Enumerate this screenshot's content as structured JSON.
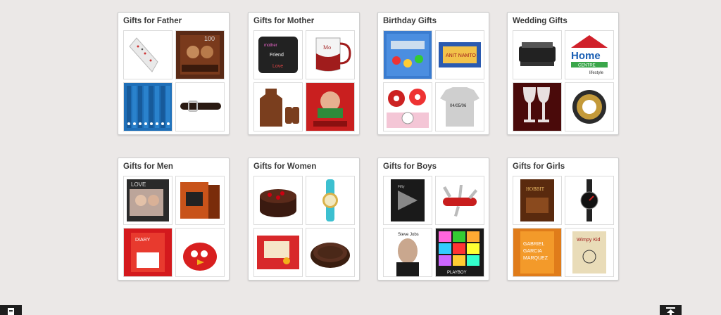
{
  "categories": [
    {
      "title": "Gifts for Father",
      "items": [
        "tie",
        "dvd",
        "books",
        "belt"
      ]
    },
    {
      "title": "Gifts for Mother",
      "items": [
        "cushion",
        "mug",
        "apron",
        "cookbook"
      ]
    },
    {
      "title": "Birthday Gifts",
      "items": [
        "toy-kit",
        "name-banner",
        "cupcakes",
        "tshirt"
      ],
      "image_text": {
        "name-banner": "ANIT NAMTO",
        "tshirt": "04/05/06"
      }
    },
    {
      "title": "Wedding Gifts",
      "items": [
        "grill",
        "home-centre-logo",
        "wine-glasses",
        "wreath"
      ],
      "image_text": {
        "home-centre-logo": "Home",
        "home-centre-logo-sub": "CENTRE",
        "home-centre-logo-brand": "lifestyle"
      }
    },
    {
      "title": "Gifts for Men",
      "items": [
        "photo-frame",
        "book-box-set",
        "diary-book",
        "angry-bird"
      ]
    },
    {
      "title": "Gifts for Women",
      "items": [
        "cake",
        "watch",
        "card",
        "chocolate-cake"
      ]
    },
    {
      "title": "Gifts for Boys",
      "items": [
        "novel",
        "swiss-knife",
        "biography",
        "pop-art"
      ]
    },
    {
      "title": "Gifts for Girls",
      "items": [
        "hobbit-book",
        "black-watch",
        "marquez-book",
        "kid-book"
      ]
    }
  ],
  "colors": {
    "background": "#ebe8e7",
    "card_border": "#cfcfcf",
    "title": "#3a3a3a",
    "corner_button": "#1e1e1e"
  },
  "icons": {
    "left_corner": "document-icon",
    "right_corner": "scroll-to-top-icon"
  }
}
